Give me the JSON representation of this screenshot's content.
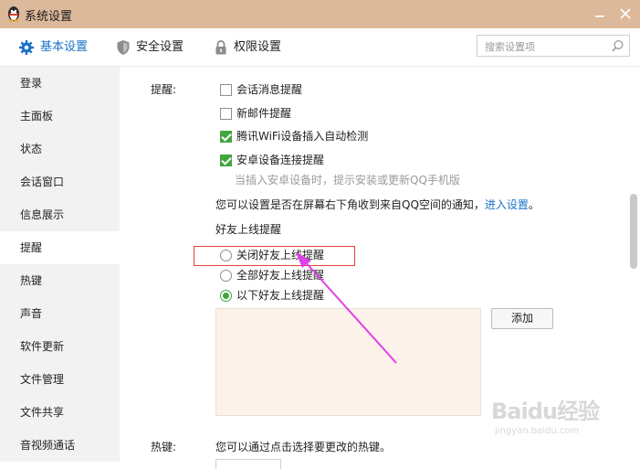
{
  "window": {
    "title": "系统设置",
    "minimize_icon": "minimize-icon",
    "close_icon": "close-icon"
  },
  "toolbar": {
    "tabs": [
      {
        "label": "基本设置",
        "icon": "gear-icon",
        "active": true
      },
      {
        "label": "安全设置",
        "icon": "shield-icon",
        "active": false
      },
      {
        "label": "权限设置",
        "icon": "lock-icon",
        "active": false
      }
    ],
    "search": {
      "placeholder": "搜索设置项",
      "value": "",
      "icon": "search-icon"
    }
  },
  "sidebar": {
    "items": [
      {
        "label": "登录"
      },
      {
        "label": "主面板"
      },
      {
        "label": "状态"
      },
      {
        "label": "会话窗口"
      },
      {
        "label": "信息展示"
      },
      {
        "label": "提醒",
        "active": true
      },
      {
        "label": "热键"
      },
      {
        "label": "声音"
      },
      {
        "label": "软件更新"
      },
      {
        "label": "文件管理"
      },
      {
        "label": "文件共享"
      },
      {
        "label": "音视频通话"
      }
    ]
  },
  "reminder": {
    "section_label": "提醒:",
    "options": [
      {
        "label": "会话消息提醒",
        "checked": false
      },
      {
        "label": "新邮件提醒",
        "checked": false
      },
      {
        "label": "腾讯WiFi设备插入自动检测",
        "checked": true
      },
      {
        "label": "安卓设备连接提醒",
        "checked": true
      }
    ],
    "android_hint": "当插入安卓设备时，提示安装或更新QQ手机版",
    "qzone_notice": "您可以设置是否在屏幕右下角收到来自QQ空间的通知，",
    "qzone_link": "进入设置",
    "qzone_period": "。",
    "friend_online": {
      "title": "好友上线提醒",
      "options": [
        {
          "label": "关闭好友上线提醒",
          "selected": false
        },
        {
          "label": "全部好友上线提醒",
          "selected": false
        },
        {
          "label": "以下好友上线提醒",
          "selected": true
        }
      ],
      "add_button": "添加"
    }
  },
  "hotkey": {
    "section_label": "热键:",
    "description": "您可以通过点击选择要更改的热键。"
  },
  "watermark": {
    "brand": "Baidu经验",
    "sub": "jingyan.baidu.com"
  },
  "colors": {
    "titlebar": "#dcb99a",
    "accent": "#1a73c9",
    "checked_green": "#41a63e",
    "annotation_red": "#e0443c",
    "annotation_arrow": "#e040e8"
  }
}
